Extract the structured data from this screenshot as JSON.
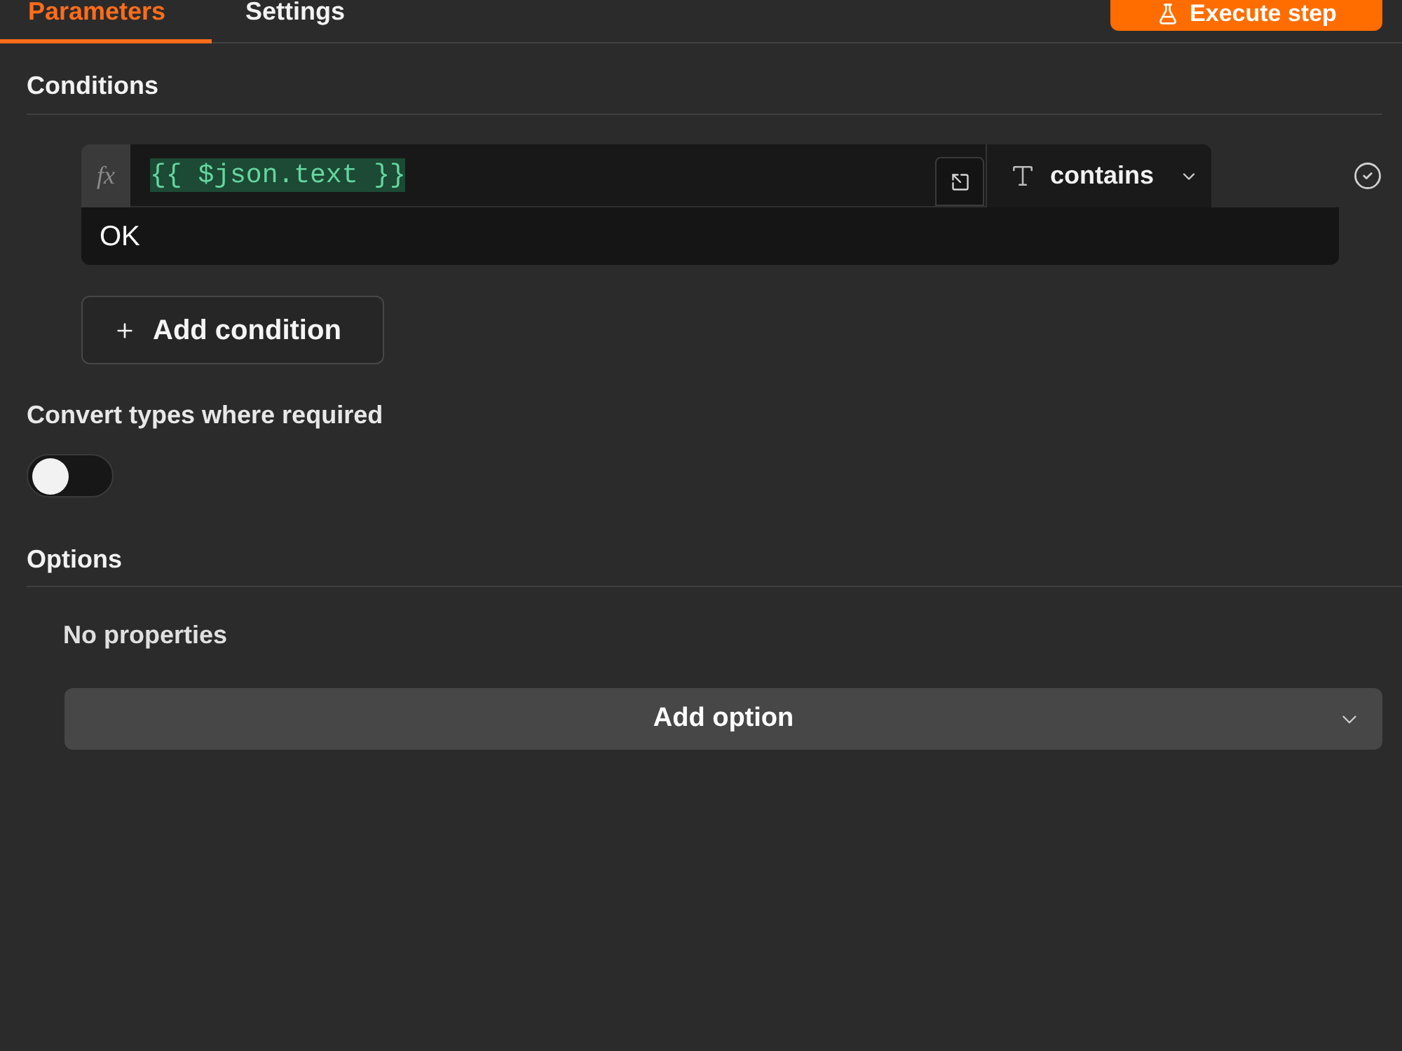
{
  "tabs": [
    {
      "label": "Parameters",
      "selected": true
    },
    {
      "label": "Settings",
      "selected": false
    }
  ],
  "execute_button": {
    "label": "Execute step"
  },
  "conditions": {
    "title": "Conditions",
    "rows": [
      {
        "expression_badge": "fx",
        "left_value": "{{ $json.text }}",
        "operator": "contains",
        "right_value": "OK"
      }
    ],
    "add_button": "Add condition"
  },
  "convert_types": {
    "label": "Convert types where required",
    "on": false
  },
  "options": {
    "title": "Options",
    "empty_text": "No properties",
    "add_button": "Add option"
  }
}
